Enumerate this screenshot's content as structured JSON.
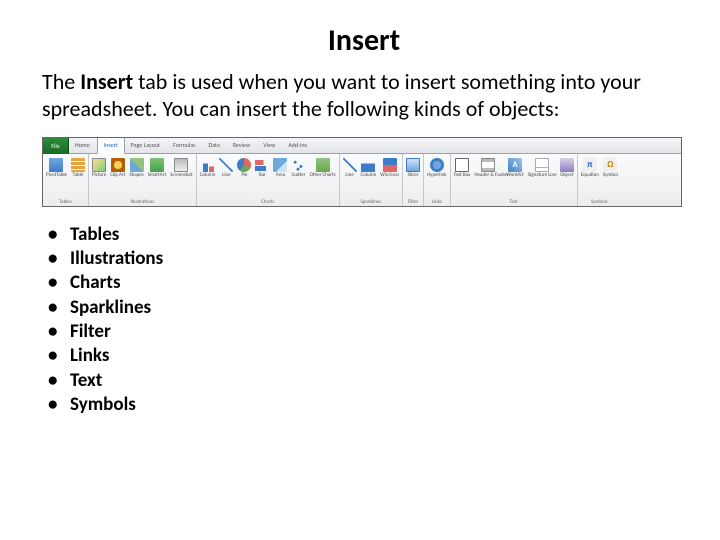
{
  "title": "Insert",
  "intro_pre": "The ",
  "intro_bold": "Insert",
  "intro_post": " tab is used when you want to insert something into your spreadsheet. You can insert the following kinds of objects:",
  "tabs": {
    "file": "File",
    "home": "Home",
    "insert": "Insert",
    "page_layout": "Page Layout",
    "formulas": "Formulas",
    "data": "Data",
    "review": "Review",
    "view": "View",
    "addins": "Add-Ins"
  },
  "ribbon": {
    "tables": {
      "label": "Tables",
      "pivot": "PivotTable",
      "table": "Table"
    },
    "illustrations": {
      "label": "Illustrations",
      "picture": "Picture",
      "clipart": "Clip Art",
      "shapes": "Shapes",
      "smartart": "SmartArt",
      "screenshot": "Screenshot"
    },
    "charts": {
      "label": "Charts",
      "column": "Column",
      "line": "Line",
      "pie": "Pie",
      "bar": "Bar",
      "area": "Area",
      "scatter": "Scatter",
      "other": "Other Charts"
    },
    "sparklines": {
      "label": "Sparklines",
      "line": "Line",
      "column": "Column",
      "winloss": "Win/Loss"
    },
    "filter": {
      "label": "Filter",
      "slicer": "Slicer"
    },
    "links": {
      "label": "Links",
      "hyperlink": "Hyperlink"
    },
    "text": {
      "label": "Text",
      "textbox": "Text Box",
      "hf": "Header & Footer",
      "wordart": "WordArt",
      "sig": "Signature Line",
      "object": "Object"
    },
    "symbols": {
      "label": "Symbols",
      "equation": "Equation",
      "symbol": "Symbol"
    }
  },
  "bullets": [
    "Tables",
    "Illustrations",
    "Charts",
    "Sparklines",
    "Filter",
    "Links",
    "Text",
    "Symbols"
  ]
}
